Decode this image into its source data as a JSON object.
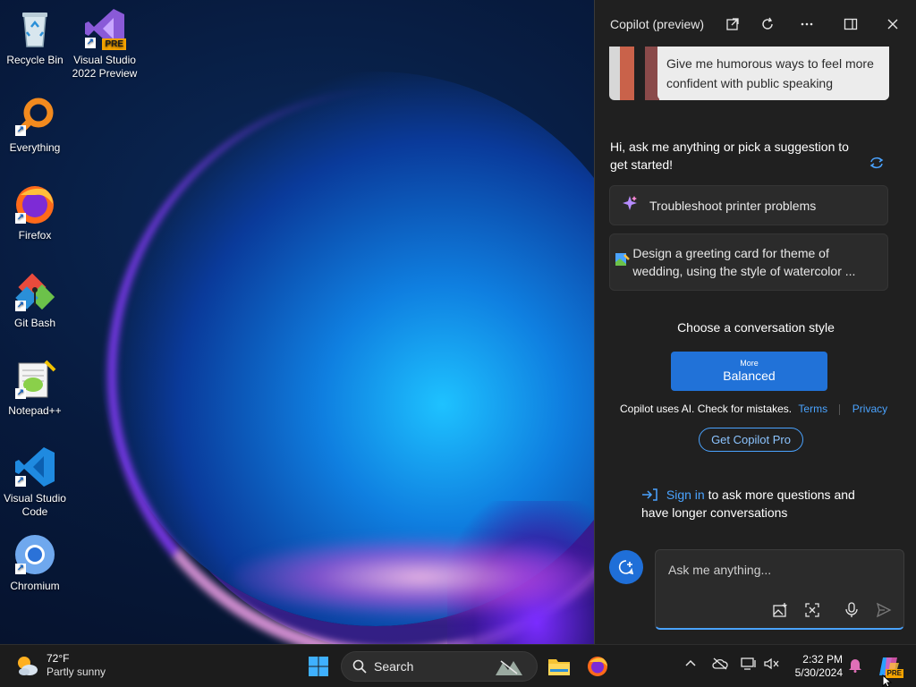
{
  "desktop": {
    "icons": [
      {
        "label": "Recycle Bin"
      },
      {
        "label": "Visual Studio 2022 Preview",
        "badge": "PRE"
      },
      {
        "label": "Everything"
      },
      {
        "label": "Firefox"
      },
      {
        "label": "Git Bash"
      },
      {
        "label": "Notepad++"
      },
      {
        "label": "Visual Studio Code"
      },
      {
        "label": "Chromium"
      }
    ]
  },
  "copilot": {
    "title": "Copilot (preview)",
    "banner_text": "Give me humorous ways to feel more confident with public speaking",
    "greeting": "Hi, ask me anything or pick a suggestion to get started!",
    "suggestions": [
      {
        "label": "Troubleshoot printer problems",
        "icon": "sparkle-icon"
      },
      {
        "label": "Design a greeting card for theme of wedding, using the style of watercolor ...",
        "icon": "image-create-icon"
      }
    ],
    "style_title": "Choose a conversation style",
    "style_more": "More",
    "style_selected": "Balanced",
    "disclaimer": "Copilot uses AI. Check for mistakes.",
    "terms": "Terms",
    "privacy": "Privacy",
    "pro_button": "Get Copilot Pro",
    "signin_link": "Sign in",
    "signin_text": " to ask more questions and have longer conversations",
    "chat_placeholder": "Ask me anything...",
    "accent": "#2172d8"
  },
  "taskbar": {
    "weather_temp": "72°F",
    "weather_desc": "Partly sunny",
    "search_label": "Search",
    "time": "2:32 PM",
    "date": "5/30/2024",
    "copilot_badge": "PRE"
  }
}
